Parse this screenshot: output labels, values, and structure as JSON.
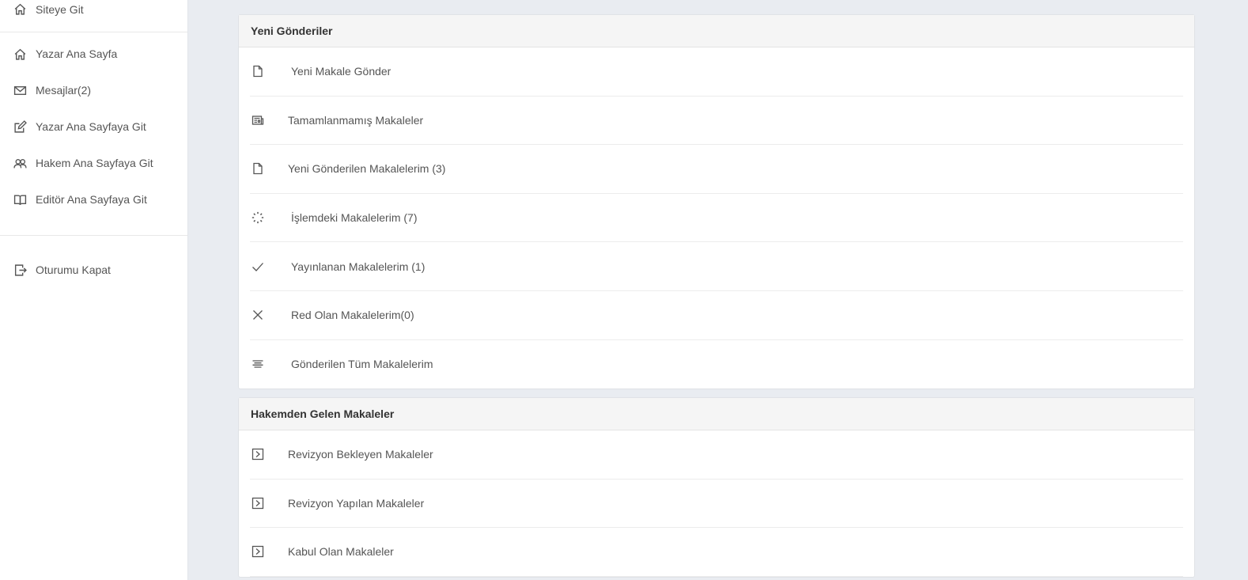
{
  "sidebar": {
    "groups": [
      {
        "items": [
          {
            "label": "Siteye Git",
            "icon": "home-icon"
          }
        ]
      },
      {
        "items": [
          {
            "label": "Yazar Ana Sayfa",
            "icon": "home-icon"
          },
          {
            "label": "Mesajlar(2)",
            "icon": "envelope-icon"
          },
          {
            "label": "Yazar Ana Sayfaya Git",
            "icon": "edit-icon"
          },
          {
            "label": "Hakem Ana Sayfaya Git",
            "icon": "users-icon"
          },
          {
            "label": "Editör Ana Sayfaya Git",
            "icon": "book-icon"
          }
        ]
      },
      {
        "items": [
          {
            "label": "Oturumu Kapat",
            "icon": "logout-icon"
          }
        ]
      }
    ]
  },
  "cards": [
    {
      "title": "Yeni Gönderiler",
      "items": [
        {
          "label": "Yeni Makale Gönder",
          "icon": "file-icon"
        },
        {
          "label": "Tamamlanmamış Makaleler",
          "icon": "newspaper-icon"
        },
        {
          "label": "Yeni Gönderilen Makalelerim (3)",
          "icon": "file-icon"
        },
        {
          "label": "İşlemdeki Makalelerim (7)",
          "icon": "spinner-icon"
        },
        {
          "label": "Yayınlanan Makalelerim (1)",
          "icon": "check-icon"
        },
        {
          "label": "Red Olan Makalelerim(0)",
          "icon": "close-icon"
        },
        {
          "label": "Gönderilen Tüm Makalelerim",
          "icon": "list-icon"
        }
      ]
    },
    {
      "title": "Hakemden Gelen Makaleler",
      "items": [
        {
          "label": "Revizyon Bekleyen Makaleler",
          "icon": "caret-square-right-icon"
        },
        {
          "label": "Revizyon Yapılan Makaleler",
          "icon": "caret-square-right-icon"
        },
        {
          "label": "Kabul Olan Makaleler",
          "icon": "caret-square-right-icon"
        }
      ]
    }
  ]
}
